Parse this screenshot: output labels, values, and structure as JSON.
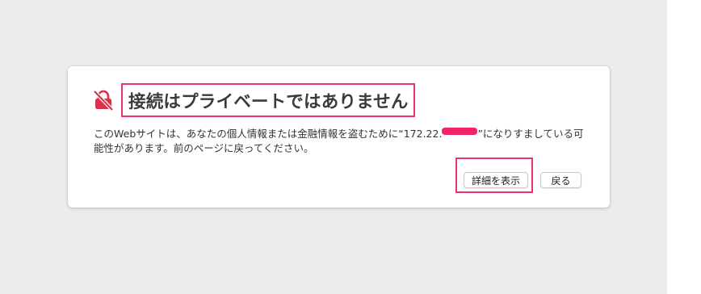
{
  "page": {
    "title": "接続はプライベートではありません",
    "description_before": "このWebサイトは、あなたの個人情報または金融情報を盗むために“172.22.",
    "description_after": "”になりすましている可能性があります。前のページに戻ってください。",
    "warning_icon": "lock-slash-icon"
  },
  "buttons": {
    "details_label": "詳細を表示",
    "back_label": "戻る"
  },
  "colors": {
    "warning_icon": "#d8334a",
    "highlight": "#e8336e",
    "redaction": "#f0226b",
    "background": "#ececed"
  }
}
